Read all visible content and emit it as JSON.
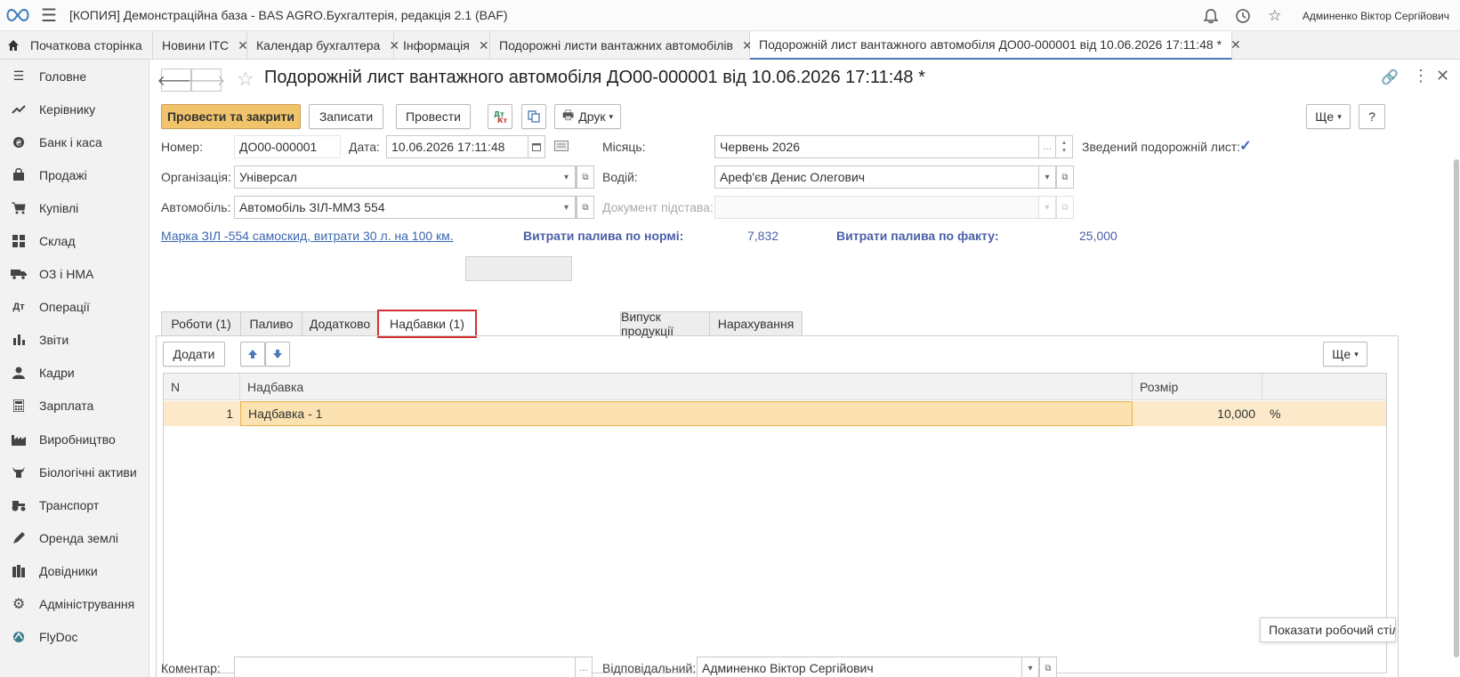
{
  "app": {
    "title": "[КОПИЯ] Демонстраційна база - BAS AGRO.Бухгалтерія, редакція 2.1  (BAF)",
    "user": "Админенко Віктор Сергійович"
  },
  "open_tabs": [
    {
      "label": "Початкова сторінка"
    },
    {
      "label": "Новини ІТС"
    },
    {
      "label": "Календар бухгалтера"
    },
    {
      "label": "Інформація"
    },
    {
      "label": "Подорожні листи вантажних автомобілів"
    },
    {
      "label": "Подорожній лист вантажного автомобіля ДО00-000001 від 10.06.2026 17:11:48 *"
    }
  ],
  "sidebar": {
    "items": [
      {
        "label": "Головне",
        "icon": "menu-lines-icon"
      },
      {
        "label": "Керівнику",
        "icon": "trend-icon"
      },
      {
        "label": "Банк і каса",
        "icon": "coin-icon"
      },
      {
        "label": "Продажі",
        "icon": "bag-icon"
      },
      {
        "label": "Купівлі",
        "icon": "cart-icon"
      },
      {
        "label": "Склад",
        "icon": "warehouse-icon"
      },
      {
        "label": "ОЗ і НМА",
        "icon": "truck-icon"
      },
      {
        "label": "Операції",
        "icon": "operations-icon"
      },
      {
        "label": "Звіти",
        "icon": "bar-chart-icon"
      },
      {
        "label": "Кадри",
        "icon": "person-icon"
      },
      {
        "label": "Зарплата",
        "icon": "calculator-icon"
      },
      {
        "label": "Виробництво",
        "icon": "factory-icon"
      },
      {
        "label": "Біологічні активи",
        "icon": "cow-icon"
      },
      {
        "label": "Транспорт",
        "icon": "tractor-icon"
      },
      {
        "label": "Оренда землі",
        "icon": "pen-icon"
      },
      {
        "label": "Довідники",
        "icon": "books-icon"
      },
      {
        "label": "Адміністрування",
        "icon": "gear-icon"
      },
      {
        "label": "FlyDoc",
        "icon": "flydoc-icon"
      }
    ]
  },
  "document": {
    "title": "Подорожній лист вантажного автомобіля ДО00-000001 від 10.06.2026 17:11:48 *",
    "toolbar": {
      "post_and_close": "Провести та закрити",
      "save": "Записати",
      "post": "Провести",
      "print": "Друк",
      "more": "Ще",
      "help": "?"
    },
    "fields": {
      "number_label": "Номер:",
      "number": "ДО00-000001",
      "date_label": "Дата:",
      "date": "10.06.2026 17:11:48",
      "month_label": "Місяць:",
      "month": "Червень 2026",
      "consolidated_label": "Зведений подорожній лист:",
      "consolidated_checked": true,
      "organization_label": "Організація:",
      "organization": "Універсал",
      "driver_label": "Водій:",
      "driver": "Ареф'єв Денис Олегович",
      "vehicle_label": "Автомобіль:",
      "vehicle": "Автомобіль ЗІЛ-ММЗ  554",
      "basis_label": "Документ підстава:",
      "basis": "",
      "comment_label": "Коментар:",
      "comment": "",
      "responsible_label": "Відповідальний:",
      "responsible": "Админенко Віктор Сергійович"
    },
    "info": {
      "vehicle_link": "Марка ЗІЛ -554 самоскид, витрати 30 л. на 100 км.",
      "norm_label": "Витрати палива по нормі:",
      "norm_value": "7,832",
      "fact_label": "Витрати палива по факту:",
      "fact_value": "25,000"
    },
    "tabs": [
      {
        "label": "Роботи (1)"
      },
      {
        "label": "Паливо"
      },
      {
        "label": "Додатково"
      },
      {
        "label": "Надбавки (1)"
      },
      {
        "label": "Випуск продукції"
      },
      {
        "label": "Нарахування"
      }
    ],
    "active_tab": "Надбавки (1)",
    "table_toolbar": {
      "add": "Додати",
      "more": "Ще"
    },
    "table": {
      "columns": [
        "N",
        "Надбавка",
        "Розмір",
        ""
      ],
      "rows": [
        {
          "n": "1",
          "name": "Надбавка - 1",
          "size": "10,000",
          "unit": "%"
        }
      ]
    }
  },
  "tooltip": "Показати робочий стіл",
  "colors": {
    "primary_button": "#f1c36a",
    "active_tab_highlight": "#d32f2f",
    "link": "#3b66b0",
    "selected_row": "#fbe9c9"
  }
}
